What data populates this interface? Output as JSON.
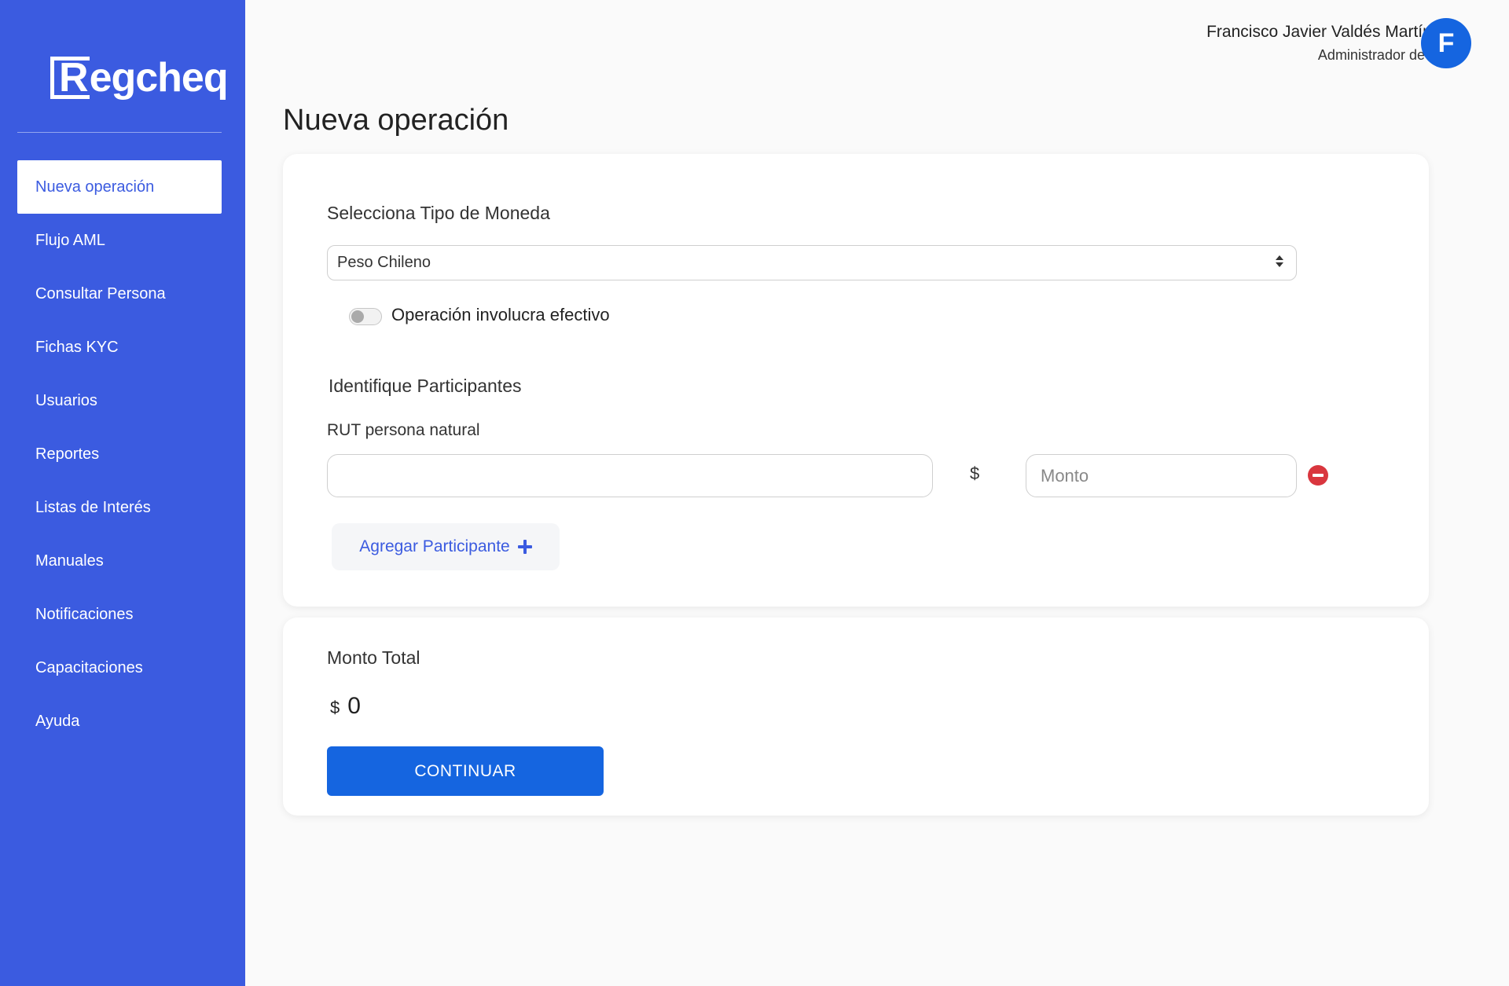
{
  "app": {
    "logo_text_box": "R",
    "logo_text_rest": "egcheq"
  },
  "sidebar": {
    "items": [
      {
        "label": "Nueva operación",
        "active": true
      },
      {
        "label": "Flujo AML"
      },
      {
        "label": "Consultar Persona"
      },
      {
        "label": "Fichas KYC"
      },
      {
        "label": "Usuarios"
      },
      {
        "label": "Reportes"
      },
      {
        "label": "Listas de Interés"
      },
      {
        "label": "Manuales"
      },
      {
        "label": "Notificaciones"
      },
      {
        "label": "Capacitaciones"
      },
      {
        "label": "Ayuda"
      }
    ]
  },
  "user": {
    "name": "Francisco Javier Valdés Martínez",
    "role": "Administrador de SO",
    "avatar_initial": "F"
  },
  "page": {
    "title": "Nueva operación"
  },
  "form": {
    "currency_label": "Selecciona Tipo de Moneda",
    "currency_value": "Peso Chileno",
    "cash_toggle_label": "Operación involucra efectivo",
    "cash_toggle_on": false,
    "participants_heading": "Identifique Participantes",
    "rut_label": "RUT  persona natural",
    "rut_value": "",
    "currency_symbol": "$",
    "amount_placeholder": "Monto",
    "add_participant_label": "Agregar Participante"
  },
  "total": {
    "label": "Monto Total",
    "currency_symbol": "$",
    "amount": "0",
    "continue_label": "CONTINUAR"
  },
  "colors": {
    "sidebar": "#3b5be0",
    "primary_button": "#1565e0",
    "remove_icon": "#d9363e"
  }
}
